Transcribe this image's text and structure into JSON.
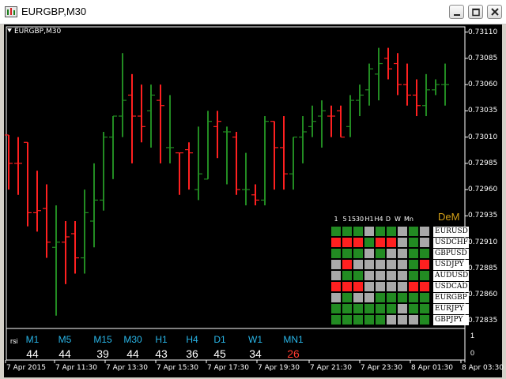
{
  "window": {
    "title": "EURGBP,M30"
  },
  "chart": {
    "symbol_label": "EURGBP,M30",
    "price_labels": [
      "0.73110",
      "0.73085",
      "0.73060",
      "0.73035",
      "0.73010",
      "0.72985",
      "0.72960",
      "0.72935",
      "0.72910",
      "0.72885",
      "0.72860",
      "0.72835"
    ],
    "time_labels": [
      "7 Apr 2015",
      "7 Apr 11:30",
      "7 Apr 13:30",
      "7 Apr 15:30",
      "7 Apr 17:30",
      "7 Apr 19:30",
      "7 Apr 21:30",
      "7 Apr 23:30",
      "8 Apr 01:30",
      "8 Apr 03:30"
    ],
    "colors": {
      "up": "#228b22",
      "down": "#ff2020",
      "background": "#000000",
      "grid": "#ffffff"
    }
  },
  "chart_data": {
    "type": "ohlc",
    "symbol": "EURGBP",
    "timeframe": "M30",
    "ylim": [
      0.7283,
      0.73115
    ],
    "bars": [
      {
        "o": 0.73012,
        "h": 0.73012,
        "l": 0.7296,
        "c": 0.72985,
        "dir": "down"
      },
      {
        "o": 0.72985,
        "h": 0.7301,
        "l": 0.72955,
        "c": 0.72985,
        "dir": "down"
      },
      {
        "o": 0.73005,
        "h": 0.73005,
        "l": 0.72925,
        "c": 0.72938,
        "dir": "down"
      },
      {
        "o": 0.72938,
        "h": 0.72978,
        "l": 0.7292,
        "c": 0.7294,
        "dir": "down"
      },
      {
        "o": 0.72942,
        "h": 0.72965,
        "l": 0.72895,
        "c": 0.7291,
        "dir": "down"
      },
      {
        "o": 0.72905,
        "h": 0.72945,
        "l": 0.7284,
        "c": 0.7291,
        "dir": "up"
      },
      {
        "o": 0.7291,
        "h": 0.7293,
        "l": 0.7287,
        "c": 0.72915,
        "dir": "down"
      },
      {
        "o": 0.72918,
        "h": 0.7293,
        "l": 0.7288,
        "c": 0.72895,
        "dir": "down"
      },
      {
        "o": 0.72895,
        "h": 0.7296,
        "l": 0.7288,
        "c": 0.72938,
        "dir": "up"
      },
      {
        "o": 0.7293,
        "h": 0.72985,
        "l": 0.72905,
        "c": 0.7295,
        "dir": "up"
      },
      {
        "o": 0.7295,
        "h": 0.73015,
        "l": 0.7294,
        "c": 0.7301,
        "dir": "up"
      },
      {
        "o": 0.7301,
        "h": 0.7303,
        "l": 0.7297,
        "c": 0.7303,
        "dir": "up"
      },
      {
        "o": 0.7303,
        "h": 0.7309,
        "l": 0.7301,
        "c": 0.73045,
        "dir": "up"
      },
      {
        "o": 0.7305,
        "h": 0.7307,
        "l": 0.72985,
        "c": 0.7303,
        "dir": "down"
      },
      {
        "o": 0.7303,
        "h": 0.7306,
        "l": 0.73005,
        "c": 0.7302,
        "dir": "down"
      },
      {
        "o": 0.73035,
        "h": 0.7306,
        "l": 0.73,
        "c": 0.7305,
        "dir": "up"
      },
      {
        "o": 0.73045,
        "h": 0.7306,
        "l": 0.72985,
        "c": 0.7304,
        "dir": "down"
      },
      {
        "o": 0.73,
        "h": 0.7305,
        "l": 0.72985,
        "c": 0.73,
        "dir": "up"
      },
      {
        "o": 0.72995,
        "h": 0.72995,
        "l": 0.72955,
        "c": 0.72995,
        "dir": "down"
      },
      {
        "o": 0.72998,
        "h": 0.73005,
        "l": 0.7296,
        "c": 0.72995,
        "dir": "down"
      },
      {
        "o": 0.7296,
        "h": 0.7302,
        "l": 0.7295,
        "c": 0.72975,
        "dir": "up"
      },
      {
        "o": 0.7297,
        "h": 0.73035,
        "l": 0.7297,
        "c": 0.73025,
        "dir": "up"
      },
      {
        "o": 0.7302,
        "h": 0.73035,
        "l": 0.7299,
        "c": 0.73025,
        "dir": "down"
      },
      {
        "o": 0.73015,
        "h": 0.7302,
        "l": 0.72965,
        "c": 0.73015,
        "dir": "up"
      },
      {
        "o": 0.7301,
        "h": 0.73015,
        "l": 0.72955,
        "c": 0.7296,
        "dir": "down"
      },
      {
        "o": 0.7296,
        "h": 0.72995,
        "l": 0.72945,
        "c": 0.7296,
        "dir": "up"
      },
      {
        "o": 0.72955,
        "h": 0.72965,
        "l": 0.72945,
        "c": 0.7295,
        "dir": "down"
      },
      {
        "o": 0.7295,
        "h": 0.7303,
        "l": 0.72945,
        "c": 0.73025,
        "dir": "up"
      },
      {
        "o": 0.73025,
        "h": 0.73025,
        "l": 0.7296,
        "c": 0.73,
        "dir": "down"
      },
      {
        "o": 0.73,
        "h": 0.7303,
        "l": 0.7296,
        "c": 0.72975,
        "dir": "down"
      },
      {
        "o": 0.72975,
        "h": 0.7301,
        "l": 0.7296,
        "c": 0.7301,
        "dir": "up"
      },
      {
        "o": 0.7301,
        "h": 0.7303,
        "l": 0.72985,
        "c": 0.73015,
        "dir": "up"
      },
      {
        "o": 0.7302,
        "h": 0.7304,
        "l": 0.7301,
        "c": 0.73025,
        "dir": "up"
      },
      {
        "o": 0.7303,
        "h": 0.73045,
        "l": 0.73,
        "c": 0.73035,
        "dir": "up"
      },
      {
        "o": 0.7303,
        "h": 0.7304,
        "l": 0.7301,
        "c": 0.7303,
        "dir": "down"
      },
      {
        "o": 0.73035,
        "h": 0.7304,
        "l": 0.7301,
        "c": 0.7301,
        "dir": "down"
      },
      {
        "o": 0.7302,
        "h": 0.7305,
        "l": 0.7301,
        "c": 0.73045,
        "dir": "up"
      },
      {
        "o": 0.73045,
        "h": 0.7306,
        "l": 0.7303,
        "c": 0.7305,
        "dir": "up"
      },
      {
        "o": 0.73055,
        "h": 0.7308,
        "l": 0.7304,
        "c": 0.73075,
        "dir": "up"
      },
      {
        "o": 0.7307,
        "h": 0.73095,
        "l": 0.73045,
        "c": 0.7308,
        "dir": "up"
      },
      {
        "o": 0.73085,
        "h": 0.73095,
        "l": 0.73065,
        "c": 0.73075,
        "dir": "down"
      },
      {
        "o": 0.7308,
        "h": 0.7309,
        "l": 0.7305,
        "c": 0.7306,
        "dir": "down"
      },
      {
        "o": 0.7306,
        "h": 0.7308,
        "l": 0.7304,
        "c": 0.7305,
        "dir": "down"
      },
      {
        "o": 0.7305,
        "h": 0.73065,
        "l": 0.7303,
        "c": 0.7304,
        "dir": "down"
      },
      {
        "o": 0.7304,
        "h": 0.7307,
        "l": 0.7303,
        "c": 0.73055,
        "dir": "up"
      },
      {
        "o": 0.73055,
        "h": 0.73065,
        "l": 0.7305,
        "c": 0.7306,
        "dir": "up"
      },
      {
        "o": 0.7306,
        "h": 0.7308,
        "l": 0.7304,
        "c": 0.7306,
        "dir": "up"
      }
    ],
    "dem_panel": {
      "title": "DeM",
      "timeframes": [
        "1",
        "5",
        "15",
        "30",
        "H1",
        "H4",
        "D",
        "W",
        "Mn"
      ],
      "pairs": [
        "EURUSD",
        "USDCHF",
        "GBPUSD",
        "USDJPY",
        "AUDUSD",
        "USDCAD",
        "EURGBP",
        "EURJPY",
        "GBPJPY"
      ],
      "legend": {
        "G": "#228b22",
        "R": "#ff2020",
        "N": "#a9a9a9"
      },
      "cells": [
        [
          "G",
          "G",
          "G",
          "N",
          "G",
          "G",
          "N",
          "G",
          "N"
        ],
        [
          "R",
          "R",
          "R",
          "G",
          "R",
          "R",
          "N",
          "G",
          "N"
        ],
        [
          "G",
          "G",
          "G",
          "N",
          "G",
          "N",
          "N",
          "G",
          "G"
        ],
        [
          "N",
          "R",
          "N",
          "N",
          "N",
          "N",
          "N",
          "G",
          "R"
        ],
        [
          "N",
          "G",
          "G",
          "N",
          "N",
          "N",
          "N",
          "G",
          "G"
        ],
        [
          "R",
          "R",
          "R",
          "N",
          "N",
          "N",
          "N",
          "R",
          "R"
        ],
        [
          "N",
          "G",
          "N",
          "N",
          "G",
          "G",
          "G",
          "G",
          "G"
        ],
        [
          "G",
          "G",
          "G",
          "G",
          "G",
          "G",
          "N",
          "G",
          "G"
        ],
        [
          "G",
          "G",
          "G",
          "G",
          "G",
          "N",
          "N",
          "N",
          "G"
        ]
      ]
    },
    "rsi_panel": {
      "label": "rsi",
      "timeframes": [
        "M1",
        "M5",
        "M15",
        "M30",
        "H1",
        "H4",
        "D1",
        "W1",
        "MN1"
      ],
      "values": [
        "44",
        "44",
        "39",
        "44",
        "43",
        "36",
        "45",
        "34",
        "26"
      ],
      "value_colors": [
        "#ffffff",
        "#ffffff",
        "#ffffff",
        "#ffffff",
        "#ffffff",
        "#ffffff",
        "#ffffff",
        "#ffffff",
        "#ff3b2f"
      ],
      "scale_labels": [
        "1",
        "0"
      ]
    }
  }
}
